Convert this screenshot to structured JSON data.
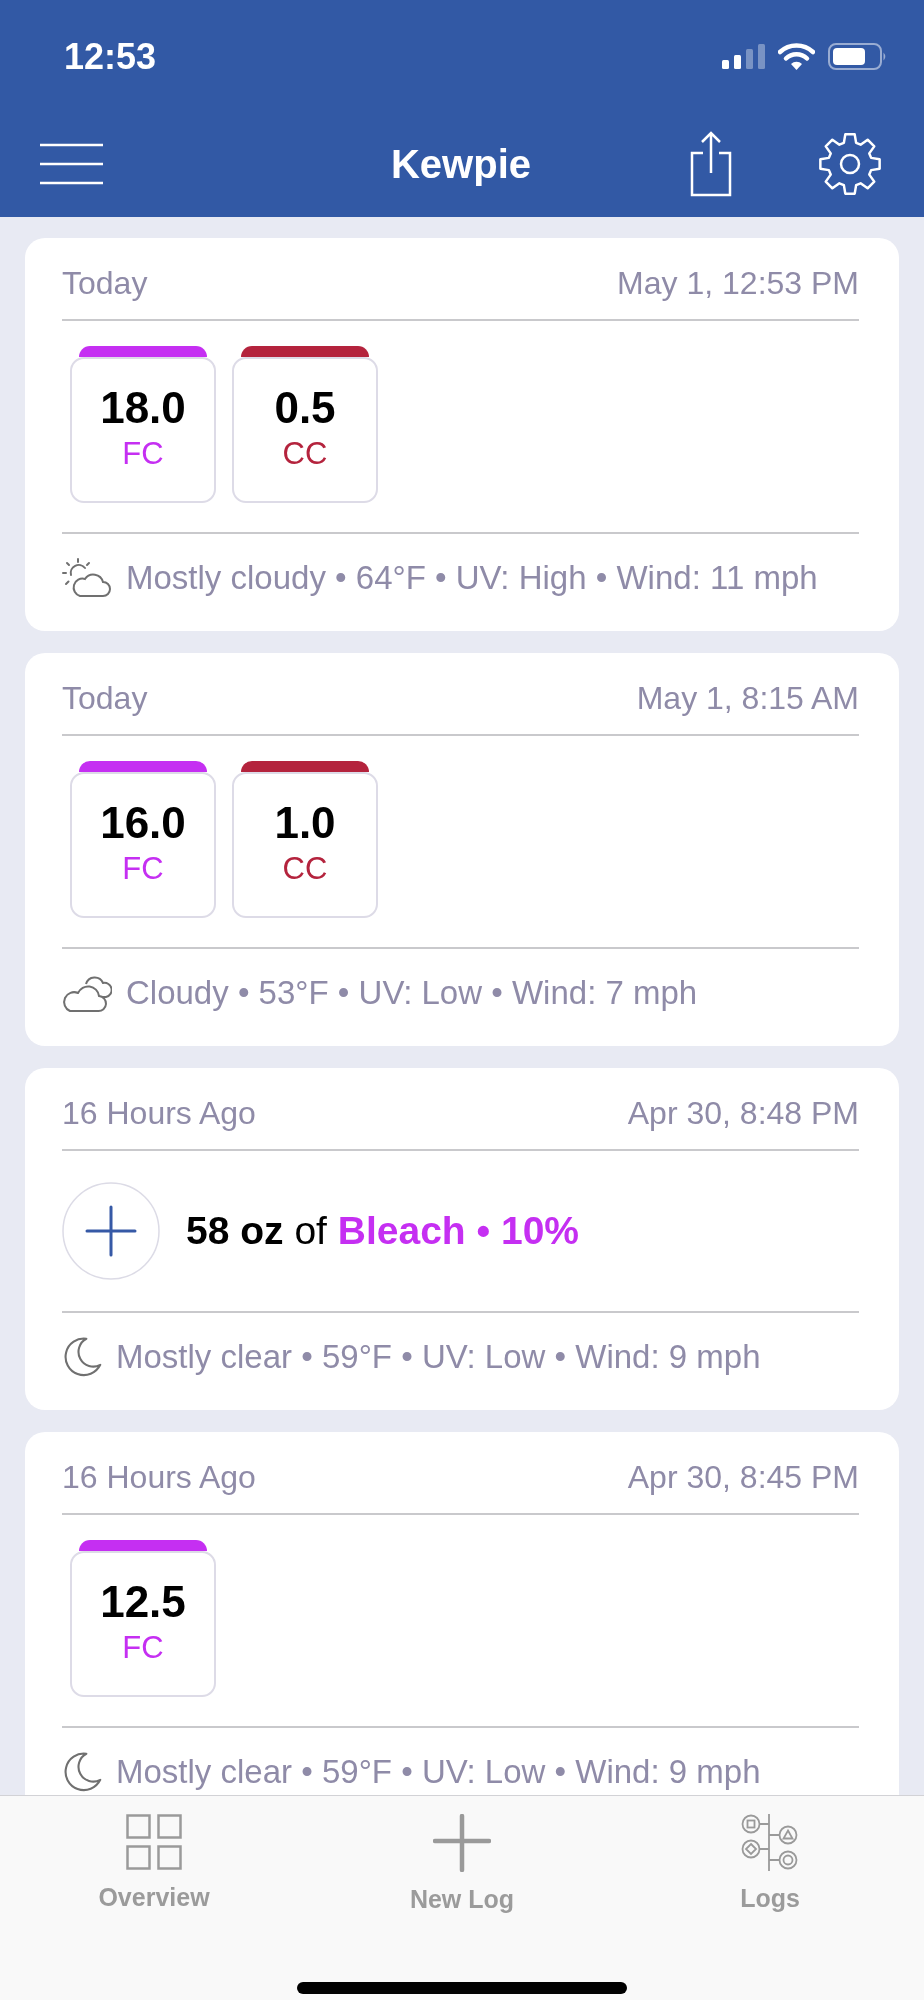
{
  "status_bar": {
    "time": "12:53"
  },
  "nav_bar": {
    "title": "Kewpie"
  },
  "logs": [
    {
      "kind": "readings",
      "relative_time": "Today",
      "timestamp": "May 1, 12:53 PM",
      "readings": [
        {
          "value": "18.0",
          "label": "FC",
          "color": "#c52ff2"
        },
        {
          "value": "0.5",
          "label": "CC",
          "color": "#b4233d"
        }
      ],
      "weather": {
        "kind": "partly_cloudy",
        "text": "Mostly cloudy • 64°F • UV: High • Wind: 11 mph"
      }
    },
    {
      "kind": "readings",
      "relative_time": "Today",
      "timestamp": "May 1, 8:15 AM",
      "readings": [
        {
          "value": "16.0",
          "label": "FC",
          "color": "#c52ff2"
        },
        {
          "value": "1.0",
          "label": "CC",
          "color": "#b4233d"
        }
      ],
      "weather": {
        "kind": "cloudy",
        "text": "Cloudy • 53°F • UV: Low • Wind: 7 mph"
      }
    },
    {
      "kind": "chemical",
      "relative_time": "16 Hours Ago",
      "timestamp": "Apr 30, 8:48 PM",
      "dose": {
        "amount": "58 oz",
        "joiner": "of",
        "chemical": "Bleach • 10%"
      },
      "weather": {
        "kind": "night_clear",
        "text": "Mostly clear • 59°F • UV: Low • Wind: 9 mph"
      }
    },
    {
      "kind": "readings",
      "relative_time": "16 Hours Ago",
      "timestamp": "Apr 30, 8:45 PM",
      "readings": [
        {
          "value": "12.5",
          "label": "FC",
          "color": "#c52ff2"
        }
      ],
      "weather": {
        "kind": "night_clear",
        "text": "Mostly clear • 59°F • UV: Low • Wind: 9 mph"
      }
    }
  ],
  "tab_bar": {
    "items": [
      {
        "kind": "overview",
        "label": "Overview"
      },
      {
        "kind": "new_log",
        "label": "New Log"
      },
      {
        "kind": "logs",
        "label": "Logs"
      }
    ]
  }
}
